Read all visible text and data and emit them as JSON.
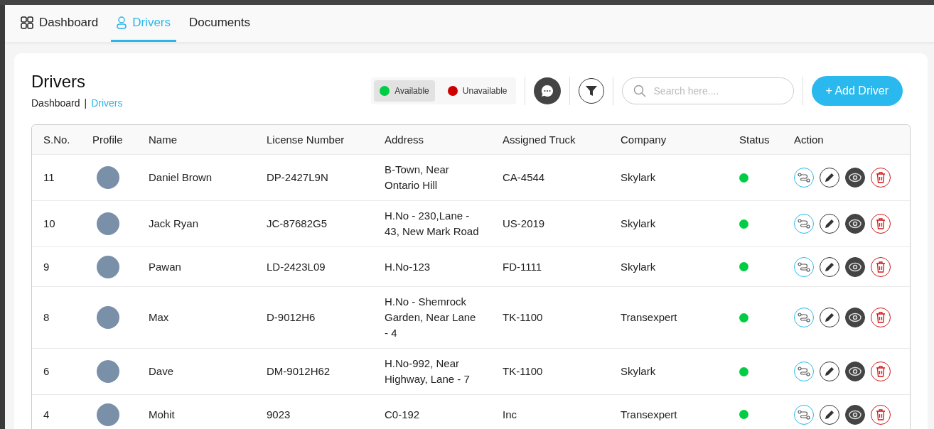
{
  "nav_tabs": [
    {
      "label": "Dashboard",
      "selected": false
    },
    {
      "label": "Drivers",
      "selected": true
    },
    {
      "label": "Documents",
      "selected": false
    }
  ],
  "page": {
    "title": "Drivers",
    "breadcrumb_separator": "|",
    "breadcrumb": [
      {
        "label": "Dashboard",
        "current": false
      },
      {
        "label": "Drivers",
        "current": true
      }
    ]
  },
  "legend": [
    {
      "label": "Available",
      "color": "#00cc44",
      "selected": true
    },
    {
      "label": "Unavailable",
      "color": "#cc0000",
      "selected": false
    }
  ],
  "search": {
    "placeholder": "Search here...."
  },
  "add_button": "+ Add Driver",
  "table": {
    "columns": [
      "S.No.",
      "Profile",
      "Name",
      "License Number",
      "Address",
      "Assigned Truck",
      "Company",
      "Status",
      "Action"
    ],
    "rows": [
      {
        "sno": "11",
        "name": "Daniel Brown",
        "license": "DP-2427L9N",
        "address": "B-Town, Near Ontario Hill",
        "truck": "CA-4544",
        "company": "Skylark",
        "available": true
      },
      {
        "sno": "10",
        "name": "Jack Ryan",
        "license": "JC-87682G5",
        "address": "H.No - 230,Lane - 43, New Mark Road",
        "truck": "US-2019",
        "company": "Skylark",
        "available": true
      },
      {
        "sno": "9",
        "name": "Pawan",
        "license": "LD-2423L09",
        "address": "H.No-123",
        "truck": "FD-1111",
        "company": "Skylark",
        "available": true
      },
      {
        "sno": "8",
        "name": "Max",
        "license": "D-9012H6",
        "address": "H.No - Shemrock Garden, Near Lane - 4",
        "truck": "TK-1100",
        "company": "Transexpert",
        "available": true
      },
      {
        "sno": "6",
        "name": "Dave",
        "license": "DM-9012H62",
        "address": "H.No-992, Near Highway, Lane - 7",
        "truck": "TK-1100",
        "company": "Skylark",
        "available": true
      },
      {
        "sno": "4",
        "name": "Mohit",
        "license": "9023",
        "address": "C0-192",
        "truck": "Inc",
        "company": "Transexpert",
        "available": true
      }
    ]
  }
}
